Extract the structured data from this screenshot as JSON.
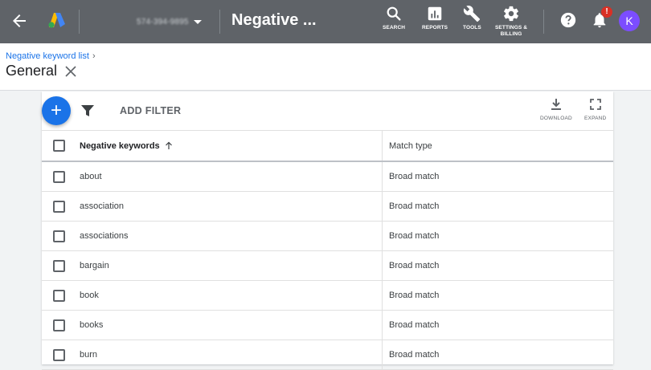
{
  "appbar": {
    "account_id": "574-394-9895",
    "page_name": "Negative ...",
    "tools": [
      {
        "label": "SEARCH",
        "icon": "search-icon"
      },
      {
        "label": "REPORTS",
        "icon": "reports-icon"
      },
      {
        "label": "TOOLS",
        "icon": "wrench-icon"
      },
      {
        "label": "SETTINGS &\nBILLING",
        "icon": "gear-icon"
      }
    ],
    "notification_badge": "!",
    "avatar_initial": "K",
    "colors": {
      "bar": "#5f6368",
      "badge": "#d93025",
      "avatar": "#7c4dff"
    }
  },
  "header": {
    "breadcrumb": "Negative keyword list",
    "title": "General"
  },
  "toolbar": {
    "add_filter": "ADD FILTER",
    "download": "DOWNLOAD",
    "expand": "EXPAND",
    "fab_color": "#1a73e8"
  },
  "table": {
    "columns": [
      "Negative keywords",
      "Match type"
    ],
    "rows": [
      {
        "keyword": "about",
        "match": "Broad match"
      },
      {
        "keyword": "association",
        "match": "Broad match"
      },
      {
        "keyword": "associations",
        "match": "Broad match"
      },
      {
        "keyword": "bargain",
        "match": "Broad match"
      },
      {
        "keyword": "book",
        "match": "Broad match"
      },
      {
        "keyword": "books",
        "match": "Broad match"
      },
      {
        "keyword": "burn",
        "match": "Broad match"
      }
    ]
  }
}
